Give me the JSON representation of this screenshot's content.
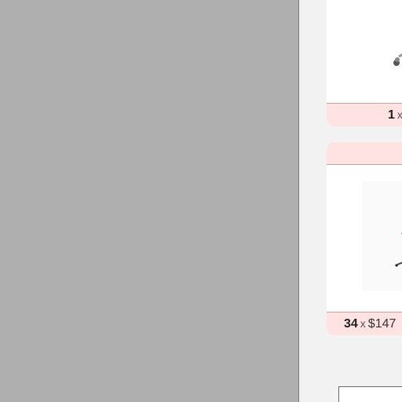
{
  "cart": {
    "items": [
      {
        "image_icon": "red-office-chair",
        "quantity": "1",
        "times_symbol": "x",
        "price": ""
      },
      {
        "image_icon": "red-drafting-stool",
        "quantity": "34",
        "times_symbol": "x",
        "price": "$147"
      }
    ]
  },
  "colors": {
    "overlay": "#afafaf",
    "panel": "#f2f2f2",
    "card_accent": "#ffe3e3",
    "chair_red": "#e23b3b"
  }
}
